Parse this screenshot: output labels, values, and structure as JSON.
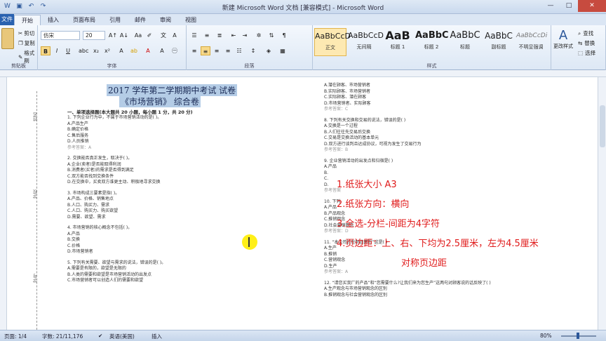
{
  "window": {
    "title": "新建 Microsoft Word 文档 [兼容模式] - Microsoft Word",
    "minimize": "—",
    "maximize": "□",
    "close": "✕"
  },
  "tabs": {
    "file": "文件",
    "items": [
      "开始",
      "插入",
      "页面布局",
      "引用",
      "邮件",
      "审阅",
      "视图"
    ]
  },
  "ribbon": {
    "clipboard": {
      "cut": "剪切",
      "copy": "复制",
      "format_painter": "格式刷",
      "label": "剪贴板"
    },
    "font": {
      "name": "仿宋",
      "size": "20",
      "label": "字体"
    },
    "paragraph": {
      "label": "段落"
    },
    "styles": {
      "items": [
        {
          "preview": "AaBbCcD",
          "name": "正文"
        },
        {
          "preview": "AaBbCcD",
          "name": "无间隔"
        },
        {
          "preview": "AaB",
          "name": "标题 1"
        },
        {
          "preview": "AaBbC",
          "name": "标题 2"
        },
        {
          "preview": "AaBbC",
          "name": "标题"
        },
        {
          "preview": "AaBbC",
          "name": "副标题"
        },
        {
          "preview": "AaBbCcDi",
          "name": "不明显强调"
        }
      ],
      "change": "更改样式",
      "label": "样式"
    },
    "editing": {
      "find": "查找",
      "replace": "替换",
      "select": "选择"
    }
  },
  "document": {
    "title1": "2017 学年第二学期期中考试 试卷",
    "title2": "《市场营销》 综合卷",
    "section": "一、单项选择题(本大题共 20 小题，每小题 1 分，共 20 分)",
    "left": [
      "1. 下列企业行为中，不属于市场营销活动的是(    )。",
      "A.产品生产",
      "B.确定价格",
      "C.售后服务",
      "D.人员推销",
      "参考答案：A",
      "",
      "2. 交换能否真正发生，取决于(    )。",
      "A.企业(卖者)是否能取得利润",
      "B.消费者(买者)的需求是否得到满足",
      "C.双方能否找到交换条件",
      "D.在交换中，买卖双方谁更主动、积极地寻求交换",
      "",
      "3. 市场构成三要素是指(    )。",
      "A.产品、价格、销售地点",
      "B.人口、购买力、需求",
      "C.人口、购买力、购买欲望",
      "D.需要、欲望、需求",
      "",
      "4. 市场营销的核心概念不包括(    )。",
      "A.产品",
      "B.交换",
      "C.价格",
      "D.市场营销者",
      "",
      "5. 下列有关需要、欲望与需求的说法，错误的是(    )。",
      "A.需要是有限的，欲望是无限的",
      "B.人类的需要和欲望是市场营销活动的出发点",
      "C.市场营销者可以创造人们的需要和欲望"
    ],
    "right": [
      "A.潜在顾客、市场营销者",
      "B.实际顾客、市场营销者",
      "C.实际顾客、潜在顾客",
      "D.市场营销者、实际顾客",
      "参考答案：C",
      "",
      "8. 下列有关交换和交易的说法，错误的是(    )",
      "A.交换是一个过程",
      "B.人们往往先交易后交换",
      "C.交易是交换活动的基本单元",
      "D.双方进行谈判且达成协议，可视为发生了交易行为",
      "参考答案：B",
      "",
      "9. 企业营销活动的出发点和归宿是(    )",
      "A.产品",
      "B.",
      "C.",
      "D.",
      "参考答案",
      "",
      "10. 下列",
      "A.产品",
      "B.产品观念",
      "C.推销观念",
      "D.社会营销观念",
      "参考答案：D",
      "",
      "11. “本公司旨在制造面粉”这是(    )",
      "A.生产",
      "B.推销",
      "C.营销观念",
      "D.生产",
      "参考答案：A",
      "",
      "12. “请您买我厂的产品”和“您需要什么?让我们来为您生产”这两句对顾客说的话反映了(    )",
      "A.生产观念与市场营销观念的区别",
      "B.推销观念与社会营销观念的区别"
    ],
    "binding": {
      "name": "姓名",
      "class": "学校",
      "id": "学号"
    }
  },
  "annotations": [
    "1.纸张大小 A3",
    "2.纸张方向：横向",
    "3.全选-分栏-间距为4字符",
    "4.页边距：上、右、下均为2.5厘米，左为4.5厘米",
    "对称页边距"
  ],
  "status": {
    "page": "页面: 1/4",
    "words": "字数: 21/11,176",
    "language": "英语(美国)",
    "mode": "插入",
    "zoom": "80%"
  }
}
